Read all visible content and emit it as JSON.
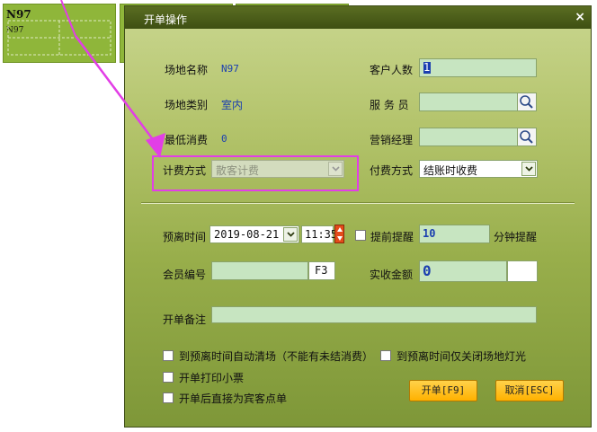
{
  "background_courts": [
    {
      "name": "N97",
      "sub": "N97"
    },
    {
      "name": "",
      "sub": ""
    },
    {
      "name": "",
      "sub": ""
    }
  ],
  "dialog": {
    "title": "开单操作",
    "close": "×",
    "fields": {
      "venue_name_label": "场地名称",
      "venue_name_value": "N97",
      "customer_count_label": "客户人数",
      "customer_count_value": "1",
      "venue_type_label": "场地类别",
      "venue_type_value": "室内",
      "waiter_label": "服 务 员",
      "min_spend_label": "最低消费",
      "min_spend_value": "0",
      "sales_manager_label": "营销经理",
      "billing_method_label": "计费方式",
      "billing_method_value": "散客计费",
      "payment_method_label": "付费方式",
      "payment_method_value": "结账时收费",
      "leave_time_label": "预离时间",
      "leave_date_value": "2019-08-21",
      "leave_clock_value": "11:35",
      "remind_label": "提前提醒",
      "remind_minutes": "10",
      "remind_suffix": "分钟提醒",
      "member_no_label": "会员编号",
      "member_key": "F3",
      "received_label": "实收金额",
      "received_value": "0",
      "note_label": "开单备注"
    },
    "options": [
      {
        "label": "到预离时间自动清场（不能有未结消费）",
        "checked": false
      },
      {
        "label": "到预离时间仅关闭场地灯光",
        "checked": false
      },
      {
        "label": "开单打印小票",
        "checked": false
      },
      {
        "label": "开单后直接为宾客点单",
        "checked": false
      }
    ],
    "buttons": {
      "open": "开单[F9]",
      "cancel": "取消[ESC]"
    }
  },
  "colors": {
    "dialog_green": "#98ae4b",
    "title_bar": "#3e4f12",
    "value_blue": "#1b3fb0",
    "highlight_magenta": "#e23ee6",
    "button_yellow": "#ffb100"
  }
}
